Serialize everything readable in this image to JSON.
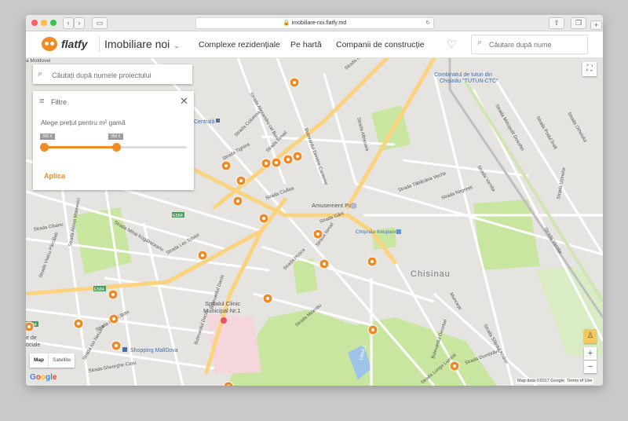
{
  "browser": {
    "url": "imobiliare-noi.flatfy.md"
  },
  "header": {
    "brand": "flatfy",
    "section_title": "Imobiliare noi",
    "nav": [
      "Complexe rezidențiale",
      "Pe hartă",
      "Companii de construcție"
    ],
    "search_placeholder": "Căutare după nume"
  },
  "panel": {
    "search_placeholder": "Căutați după numele proiectului",
    "filters_title": "Filtre",
    "price_label": "Alege prețul pentru m² gamă",
    "min_label": "350 €",
    "max_label": "350 €",
    "apply_label": "Aplica"
  },
  "map": {
    "type_buttons": [
      "Map",
      "Satellite"
    ],
    "attribution": [
      "Map data ©2017 Google",
      "Terms of Use"
    ],
    "google": "Google",
    "labels": {
      "combinat": "Combinatul de tutun din",
      "chisinau_tutun": "Chișinău \"TUTUN-CTC\"",
      "amusement": "Amusement Park",
      "chisinau_keupanee": "Chişinău Keupanee",
      "chisinau": "Chisinau",
      "spital1": "Spitalul Clinic",
      "spital2": "Municipal Nr.1",
      "mall": "Shopping MallDova",
      "centrala": "Centrală",
      "moldovei": "a Moldovei",
      "lacul": "Lacul 3",
      "sociale1": "e de",
      "sociale2": "ociale",
      "e584": "E584",
      "streets": {
        "ismail": "Strada Ismail",
        "ismail2": "Strada Ismail",
        "dacia": "Bulevardul Dacia",
        "dacia2": "Bulevardul Dacia",
        "decebal": "Bulevardul Decebal",
        "varnita": "Strada Varnița",
        "varnita2": "Strada Varnița",
        "alba": "Strada Albișoara",
        "tighina": "Strada Tighina",
        "columna": "Strada Columna",
        "banulescu": "Strada Alexandru cel Bun",
        "lex": "Strada Lex Tolstoi",
        "mihai": "Strada Mihai Kogălniceanu",
        "melestiu": "Strada Melestiu",
        "hus": "Strada Hușca",
        "gheorghe": "Strada Gheorghe Cașu",
        "pavel": "Strada Pavel Boțu",
        "ion": "Strada Ion Neculce",
        "munc": "Muncești",
        "taba": "Strada Tăbăcăria Veche",
        "negr": "Strada Negrești",
        "ciuflea": "Strada Ciuflea",
        "gari": "Strada Gării",
        "dimitrie": "Bulevardul Dimitrie Cantemir",
        "sfant": "Strada Sfântul Andrei",
        "lunga": "Strada Lunga Luminii",
        "ursoi": "Strada Uzinelor",
        "podul": "Strada Podul Înalt",
        "orhei": "Strada Orheiului",
        "mit": "Strada Mitropolit Dosoftei",
        "albu": "Strada Alexei Mateevici",
        "vlai": "Strada Vlaicu Pârcălab",
        "cibanu": "Strada Cibanu",
        "ismail3": "Strada Ismail",
        "dumb": "Strada Dumbrăvii"
      }
    }
  },
  "colors": {
    "accent": "#f08a24",
    "pin": "#f08a24",
    "park": "#c8e6a0",
    "water": "#9ec3e8",
    "hospital": "#f6d6dd"
  }
}
